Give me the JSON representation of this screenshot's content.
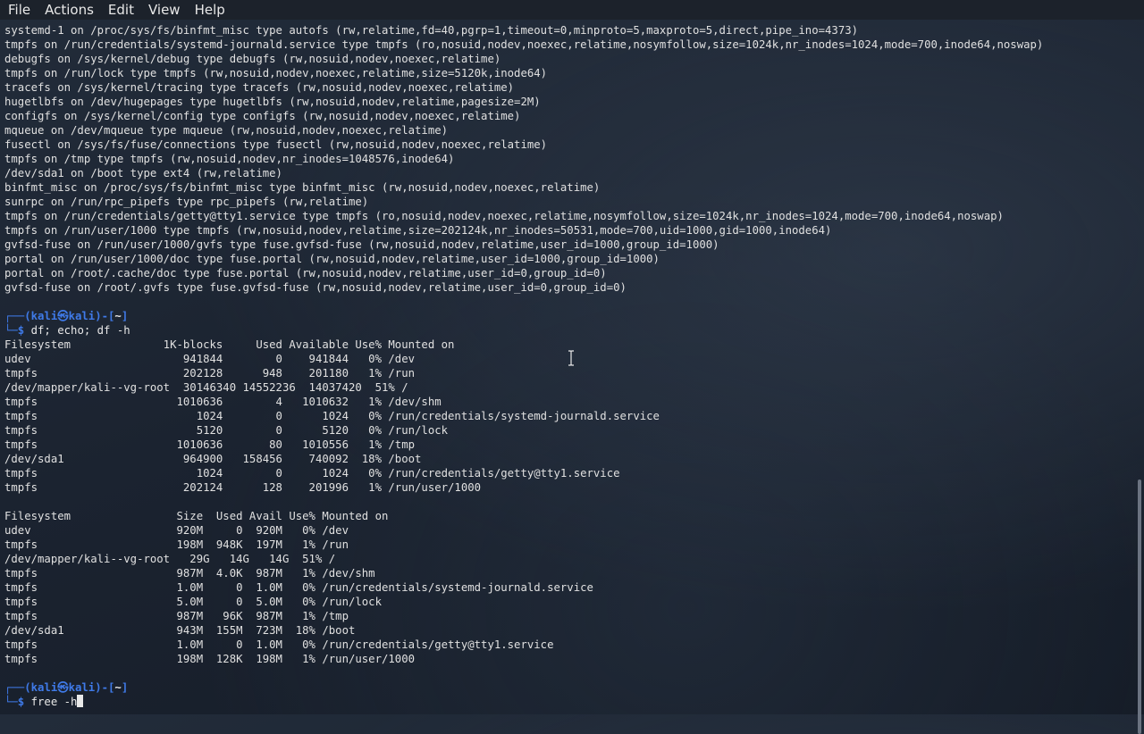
{
  "menubar": {
    "items": [
      "File",
      "Actions",
      "Edit",
      "View",
      "Help"
    ]
  },
  "terminal": {
    "mount_lines": [
      "systemd-1 on /proc/sys/fs/binfmt_misc type autofs (rw,relatime,fd=40,pgrp=1,timeout=0,minproto=5,maxproto=5,direct,pipe_ino=4373)",
      "tmpfs on /run/credentials/systemd-journald.service type tmpfs (ro,nosuid,nodev,noexec,relatime,nosymfollow,size=1024k,nr_inodes=1024,mode=700,inode64,noswap)",
      "debugfs on /sys/kernel/debug type debugfs (rw,nosuid,nodev,noexec,relatime)",
      "tmpfs on /run/lock type tmpfs (rw,nosuid,nodev,noexec,relatime,size=5120k,inode64)",
      "tracefs on /sys/kernel/tracing type tracefs (rw,nosuid,nodev,noexec,relatime)",
      "hugetlbfs on /dev/hugepages type hugetlbfs (rw,nosuid,nodev,relatime,pagesize=2M)",
      "configfs on /sys/kernel/config type configfs (rw,nosuid,nodev,noexec,relatime)",
      "mqueue on /dev/mqueue type mqueue (rw,nosuid,nodev,noexec,relatime)",
      "fusectl on /sys/fs/fuse/connections type fusectl (rw,nosuid,nodev,noexec,relatime)",
      "tmpfs on /tmp type tmpfs (rw,nosuid,nodev,nr_inodes=1048576,inode64)",
      "/dev/sda1 on /boot type ext4 (rw,relatime)",
      "binfmt_misc on /proc/sys/fs/binfmt_misc type binfmt_misc (rw,nosuid,nodev,noexec,relatime)",
      "sunrpc on /run/rpc_pipefs type rpc_pipefs (rw,relatime)",
      "tmpfs on /run/credentials/getty@tty1.service type tmpfs (ro,nosuid,nodev,noexec,relatime,nosymfollow,size=1024k,nr_inodes=1024,mode=700,inode64,noswap)",
      "tmpfs on /run/user/1000 type tmpfs (rw,nosuid,nodev,relatime,size=202124k,nr_inodes=50531,mode=700,uid=1000,gid=1000,inode64)",
      "gvfsd-fuse on /run/user/1000/gvfs type fuse.gvfsd-fuse (rw,nosuid,nodev,relatime,user_id=1000,group_id=1000)",
      "portal on /run/user/1000/doc type fuse.portal (rw,nosuid,nodev,relatime,user_id=1000,group_id=1000)",
      "portal on /root/.cache/doc type fuse.portal (rw,nosuid,nodev,relatime,user_id=0,group_id=0)",
      "gvfsd-fuse on /root/.gvfs type fuse.gvfsd-fuse (rw,nosuid,nodev,relatime,user_id=0,group_id=0)"
    ],
    "prompt1": {
      "top_prefix": "┌──(",
      "user": "kali",
      "at": "㉿",
      "host": "kali",
      "mid": ")-[",
      "dir": "~",
      "end": "]",
      "bot_prefix": "└─$ ",
      "command": "df; echo; df -h"
    },
    "df_lines": [
      "Filesystem              1K-blocks     Used Available Use% Mounted on",
      "udev                       941844        0    941844   0% /dev",
      "tmpfs                      202128      948    201180   1% /run",
      "/dev/mapper/kali--vg-root  30146340 14552236  14037420  51% /",
      "tmpfs                     1010636        4   1010632   1% /dev/shm",
      "tmpfs                        1024        0      1024   0% /run/credentials/systemd-journald.service",
      "tmpfs                        5120        0      5120   0% /run/lock",
      "tmpfs                     1010636       80   1010556   1% /tmp",
      "/dev/sda1                  964900   158456    740092  18% /boot",
      "tmpfs                        1024        0      1024   0% /run/credentials/getty@tty1.service",
      "tmpfs                      202124      128    201996   1% /run/user/1000"
    ],
    "dfh_lines": [
      "Filesystem                Size  Used Avail Use% Mounted on",
      "udev                      920M     0  920M   0% /dev",
      "tmpfs                     198M  948K  197M   1% /run",
      "/dev/mapper/kali--vg-root   29G   14G   14G  51% /",
      "tmpfs                     987M  4.0K  987M   1% /dev/shm",
      "tmpfs                     1.0M     0  1.0M   0% /run/credentials/systemd-journald.service",
      "tmpfs                     5.0M     0  5.0M   0% /run/lock",
      "tmpfs                     987M   96K  987M   1% /tmp",
      "/dev/sda1                 943M  155M  723M  18% /boot",
      "tmpfs                     1.0M     0  1.0M   0% /run/credentials/getty@tty1.service",
      "tmpfs                     198M  128K  198M   1% /run/user/1000"
    ],
    "prompt2": {
      "top_prefix": "┌──(",
      "user": "kali",
      "at": "㉿",
      "host": "kali",
      "mid": ")-[",
      "dir": "~",
      "end": "]",
      "bot_prefix": "└─$ ",
      "command": "free -h"
    }
  }
}
